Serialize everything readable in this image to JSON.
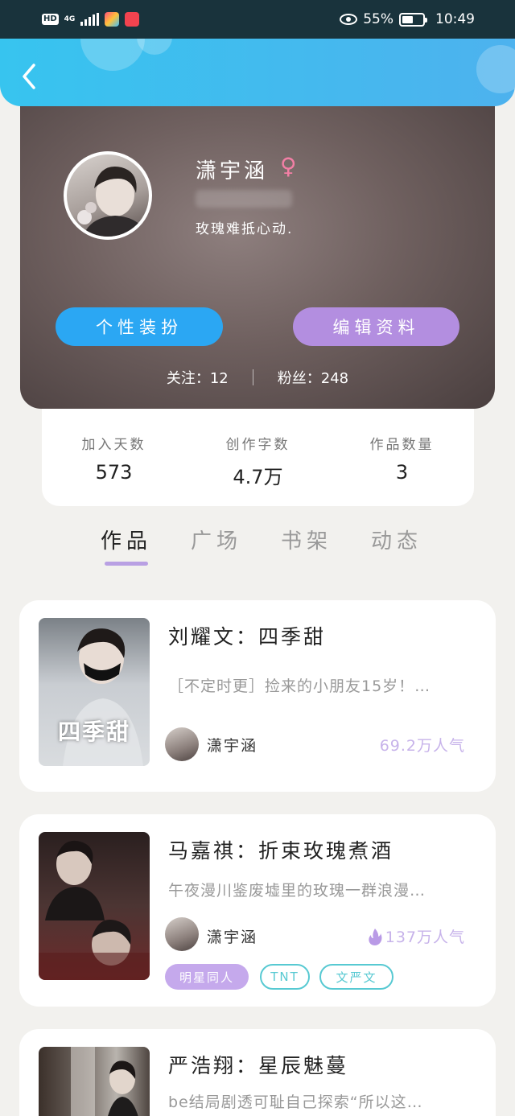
{
  "status_bar": {
    "hd": "HD",
    "network": "4G",
    "battery_percent": "55%",
    "time": "10:49",
    "battery_level": 0.55
  },
  "header": {
    "back_icon": "chevron-left-icon"
  },
  "profile": {
    "name": "潇宇涵",
    "gender_icon": "♀",
    "signature": "玫瑰难抵心动.",
    "style_button": "个性装扮",
    "edit_button": "编辑资料",
    "follow_label": "关注：12",
    "fans_label": "粉丝：248"
  },
  "stats": [
    {
      "label": "加入天数",
      "value": "573"
    },
    {
      "label": "创作字数",
      "value": "4.7万"
    },
    {
      "label": "作品数量",
      "value": "3"
    }
  ],
  "tabs": [
    {
      "label": "作品",
      "active": true
    },
    {
      "label": "广场",
      "active": false
    },
    {
      "label": "书架",
      "active": false
    },
    {
      "label": "动态",
      "active": false
    }
  ],
  "books": [
    {
      "title": "刘耀文：四季甜",
      "description": "［不定时更］捡来的小朋友15岁！…",
      "cover_text": "四季甜",
      "author": "潇宇涵",
      "popularity": "69.2万人气",
      "hot": false
    },
    {
      "title": "马嘉祺：折束玫瑰煮酒",
      "description": "午夜漫川鉴废墟里的玫瑰一群浪漫…",
      "cover_text": "",
      "author": "潇宇涵",
      "popularity": "137万人气",
      "hot": true,
      "tags": [
        "明星同人",
        "TNT",
        "文严文"
      ]
    },
    {
      "title": "严浩翔：星辰魅蔓",
      "description": "be结局剧透可耻自己探索“所以这…"
    }
  ],
  "colors": {
    "header_blue": "#37c4ef",
    "accent_purple": "#b38ee0",
    "accent_blue": "#2ba7f3",
    "tag_teal": "#57c9d2"
  }
}
